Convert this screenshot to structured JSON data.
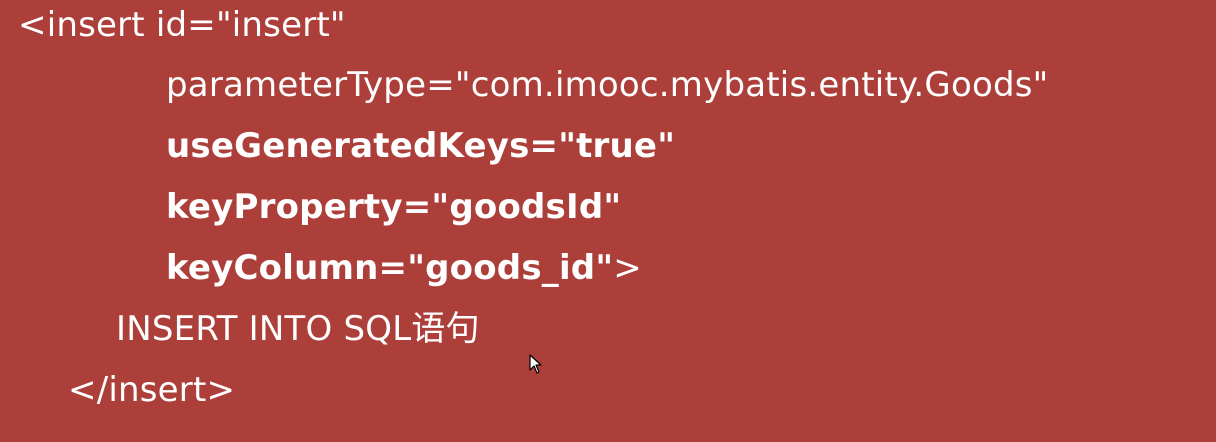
{
  "code": {
    "open_tag": "<insert id=\"insert\"",
    "parameter_type": "parameterType=\"com.imooc.mybatis.entity.Goods\"",
    "use_generated_keys": "useGeneratedKeys=\"true\"",
    "key_property": "keyProperty=\"goodsId\"",
    "key_column": "keyColumn=\"goods_id\"",
    "key_column_end": ">",
    "body": "INSERT INTO SQL语句",
    "close_tag": "</insert>"
  },
  "colors": {
    "background": "#ac3f3a",
    "text": "#ffffff"
  },
  "icons": {
    "cursor": "mouse-pointer-icon"
  }
}
